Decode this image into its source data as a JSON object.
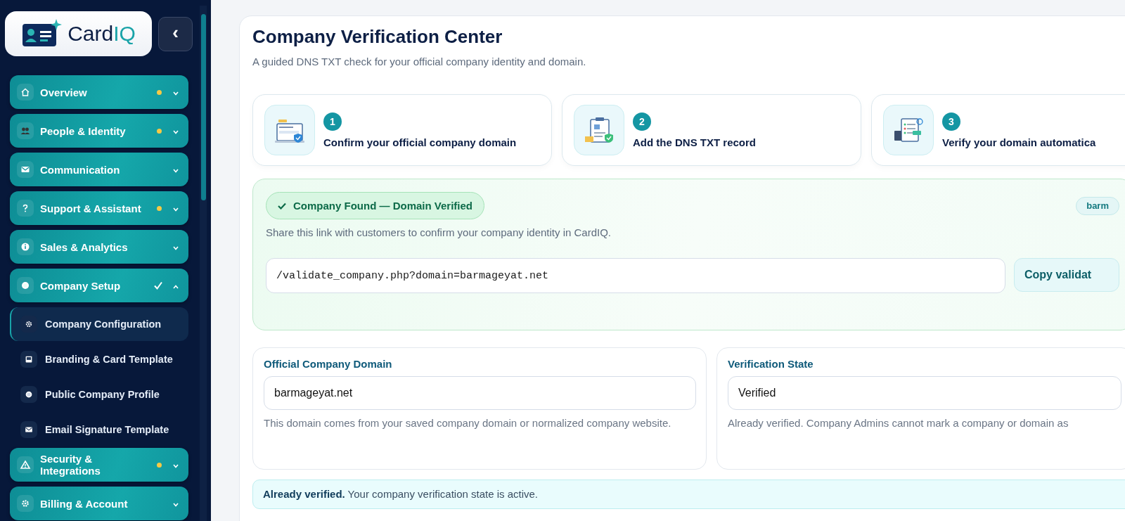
{
  "sidebar": {
    "logo": {
      "word": "Card",
      "accent": "IQ"
    },
    "collapse_button": "‹",
    "nav": [
      {
        "label": "Overview",
        "dot": true,
        "complete": false,
        "expanded": false
      },
      {
        "label": "People & Identity",
        "dot": true,
        "complete": false,
        "expanded": false
      },
      {
        "label": "Communication",
        "dot": false,
        "complete": false,
        "expanded": false
      },
      {
        "label": "Support & Assistant",
        "dot": true,
        "complete": false,
        "expanded": false
      },
      {
        "label": "Sales & Analytics",
        "dot": false,
        "complete": false,
        "expanded": false
      },
      {
        "label": "Company Setup",
        "dot": false,
        "complete": true,
        "expanded": true,
        "children": [
          {
            "label": "Company Configuration",
            "selected": true
          },
          {
            "label": "Branding & Card Template",
            "selected": false
          },
          {
            "label": "Public Company Profile",
            "selected": false
          },
          {
            "label": "Email Signature Template",
            "selected": false
          }
        ]
      },
      {
        "label": "Security & Integrations",
        "dot": true,
        "complete": false,
        "expanded": false
      },
      {
        "label": "Billing & Account",
        "dot": false,
        "complete": false,
        "expanded": false
      }
    ]
  },
  "page": {
    "title": "Company Verification Center",
    "subtitle": "A guided DNS TXT check for your official company identity and domain.",
    "steps": [
      {
        "number": "1",
        "label": "Confirm your official company domain"
      },
      {
        "number": "2",
        "label": "Add the DNS TXT record"
      },
      {
        "number": "3",
        "label": "Verify your domain automatica"
      }
    ],
    "verified_panel": {
      "status": "Company Found — Domain Verified",
      "description": "Share this link with customers to confirm your company identity in CardIQ.",
      "domain_chip": "barm",
      "link_field": {
        "value": "/validate_company.php?domain=barmageyat.net"
      },
      "copy_button": "Copy validat"
    },
    "fields": [
      {
        "label": "Official Company Domain",
        "value": "barmageyat.net",
        "help": "This domain comes from your saved company domain or normalized company website."
      },
      {
        "label": "Verification State",
        "value": "Verified",
        "help": "Already verified. Company Admins cannot mark a company or domain as"
      }
    ],
    "alert": "**Already verified.** Your company verification state is active."
  }
}
